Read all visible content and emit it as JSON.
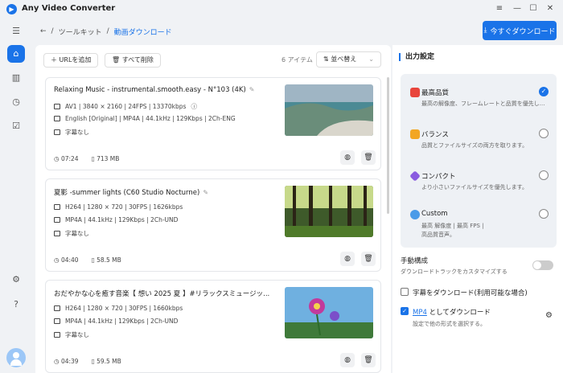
{
  "app": {
    "title": "Any Video Converter"
  },
  "window_controls": {
    "menu": "≡",
    "minimize": "—",
    "maximize": "☐",
    "close": "✕"
  },
  "breadcrumb": {
    "back": "←",
    "sep": "/",
    "root": "ツールキット",
    "current": "動画ダウンロード"
  },
  "header": {
    "download_now": "今すぐダウンロード"
  },
  "toolbar": {
    "add_url": "URLを追加",
    "delete_all": "すべて削除",
    "item_count": "6 アイテム",
    "sort": "並べ替え"
  },
  "items": [
    {
      "title": "Relaxing Music - instrumental.smooth.easy - N°103 (4K)",
      "video": "AV1 | 3840 × 2160 | 24FPS | 13370kbps",
      "audio": "English [Original] | MP4A | 44.1kHz | 129Kbps | 2Ch-ENG",
      "subtitle": "字幕なし",
      "duration": "07:24",
      "size": "713 MB"
    },
    {
      "title": "夏影 -summer lights (C60 Studio Nocturne)",
      "video": "H264 | 1280 × 720 | 30FPS | 1626kbps",
      "audio": "MP4A | 44.1kHz | 129Kbps | 2Ch-UND",
      "subtitle": "字幕なし",
      "duration": "04:40",
      "size": "58.5 MB"
    },
    {
      "title": "おだやかな心を癒す音楽【 想い 2025 夏 】#リラックスミュージッ...",
      "video": "H264 | 1280 × 720 | 30FPS | 1660kbps",
      "audio": "MP4A | 44.1kHz | 129Kbps | 2Ch-UND",
      "subtitle": "字幕なし",
      "duration": "04:39",
      "size": "59.5 MB"
    }
  ],
  "output": {
    "title": "出力設定",
    "options": [
      {
        "name": "最高品質",
        "desc1": "最高の解像度、フレームレートと品質を優先し...",
        "desc2": "",
        "selected": true
      },
      {
        "name": "バランス",
        "desc1": "品質とファイルサイズの両方を取ります。",
        "desc2": "",
        "selected": false
      },
      {
        "name": "コンパクト",
        "desc1": "より小さいファイルサイズを優先します。",
        "desc2": "",
        "selected": false
      },
      {
        "name": "Custom",
        "desc1": "最高 解像度 | 最高 FPS |",
        "desc2": "高品質音声。",
        "selected": false
      }
    ],
    "manual_title": "手動構成",
    "manual_desc": "ダウンロードトラックをカスタマイズする",
    "subtitle_check": "字幕をダウンロード(利用可能な場合)",
    "mp4_link": "MP4",
    "mp4_suffix": " としてダウンロード",
    "mp4_desc": "設定で他の形式を選択する。"
  },
  "colors": {
    "accent": "#1a73e8"
  }
}
